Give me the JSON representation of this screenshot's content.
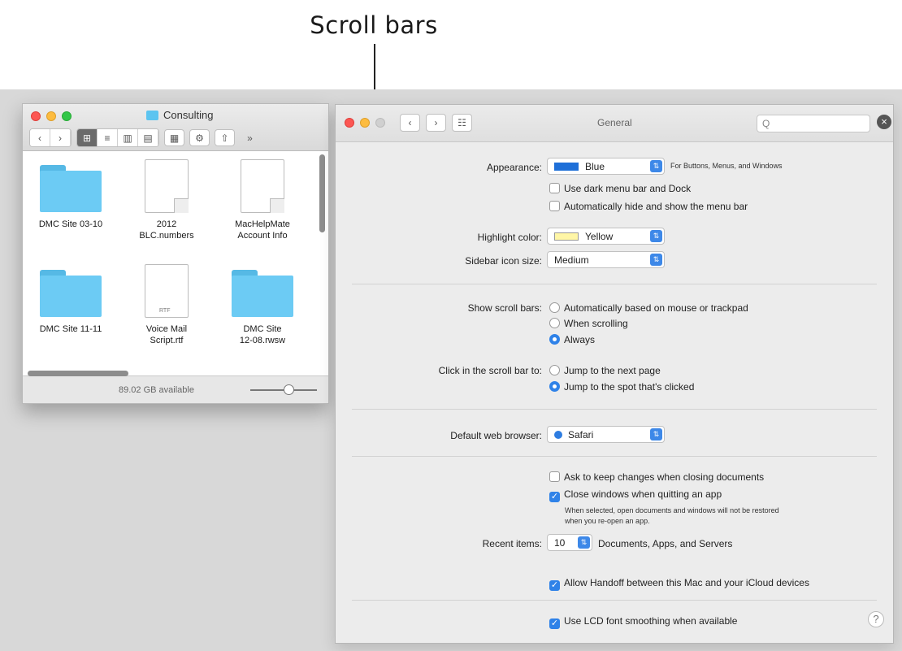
{
  "callout": "Scroll bars",
  "finder": {
    "title": "Consulting",
    "icons": [
      "back-icon",
      "forward-icon",
      "icon-view-icon",
      "list-view-icon",
      "column-view-icon",
      "gallery-view-icon",
      "group-icon",
      "gear-icon",
      "share-icon",
      "more-icon"
    ],
    "toolbar_glyphs": [
      "‹",
      "›",
      "⊞",
      "≡",
      "▥",
      "▤",
      "▦",
      "⚙",
      "⇧",
      "»"
    ],
    "items": [
      {
        "name": "DMC Site 03-10",
        "kind": "folder"
      },
      {
        "name": "2012\nBLC.numbers",
        "kind": "doc"
      },
      {
        "name": "MacHelpMate\nAccount Info",
        "kind": "doc"
      },
      {
        "name": "DMC Site 11-11",
        "kind": "folder"
      },
      {
        "name": "Voice Mail\nScript.rtf",
        "kind": "doc",
        "badge": "RTF"
      },
      {
        "name": "DMC Site\n12-08.rwsw",
        "kind": "folder"
      }
    ],
    "status": "89.02 GB available",
    "zoom_level": 0.5
  },
  "general": {
    "title": "General",
    "search_placeholder": "Q",
    "appearance": {
      "label": "Appearance:",
      "value": "Blue",
      "note": "For Buttons, Menus, and Windows"
    },
    "dark_menu": "Use dark menu bar and Dock",
    "auto_hide": "Automatically hide and show the menu bar",
    "highlight": {
      "label": "Highlight color:",
      "value": "Yellow"
    },
    "sidebar": {
      "label": "Sidebar icon size:",
      "value": "Medium"
    },
    "scroll_bars": {
      "label": "Show scroll bars:",
      "options": [
        "Automatically based on mouse or trackpad",
        "When scrolling",
        "Always"
      ],
      "selected": "Always"
    },
    "click_scroll": {
      "label": "Click in the scroll bar to:",
      "options": [
        "Jump to the next page",
        "Jump to the spot that's clicked"
      ],
      "selected": "Jump to the spot that's clicked"
    },
    "browser": {
      "label": "Default web browser:",
      "value": "Safari"
    },
    "ask_keep": "Ask to keep changes when closing documents",
    "close_windows": "Close windows when quitting an app",
    "close_note_1": "When selected, open documents and windows will not be restored",
    "close_note_2": "when you re-open an app.",
    "recent": {
      "label": "Recent items:",
      "value": "10",
      "note": "Documents, Apps, and Servers"
    },
    "handoff": "Allow Handoff between this Mac and your iCloud devices",
    "lcd": "Use LCD font smoothing when available",
    "help": "?",
    "colors": {
      "accent": "#2f82e8",
      "window": "#ececec",
      "folder": "#6ccbf4"
    }
  }
}
